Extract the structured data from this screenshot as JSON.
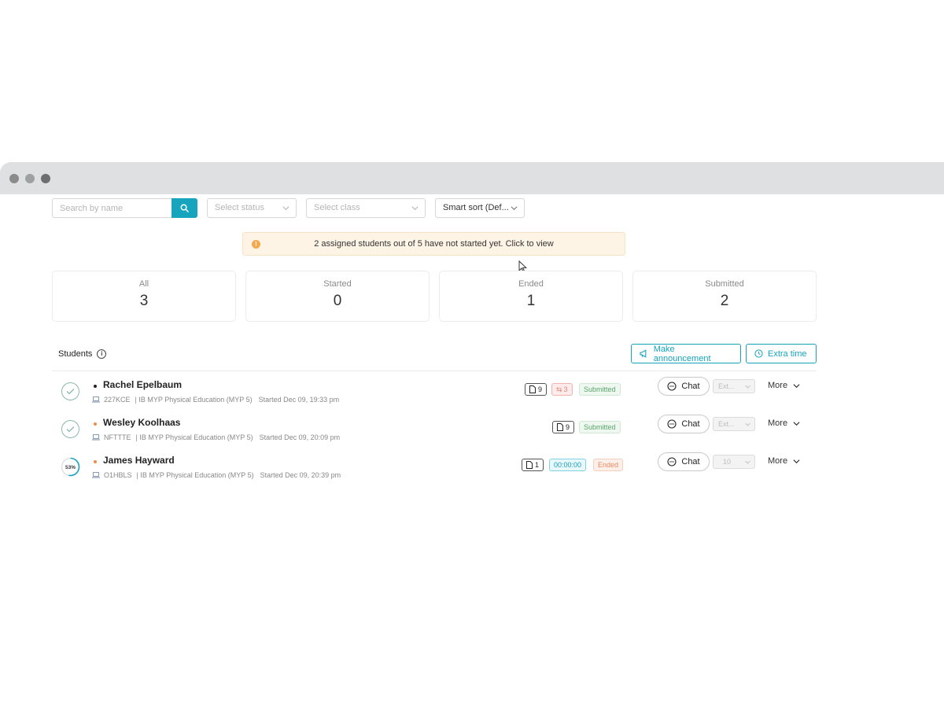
{
  "filters": {
    "search_placeholder": "Search by name",
    "status_placeholder": "Select status",
    "class_placeholder": "Select class",
    "sort_value": "Smart sort (Def..."
  },
  "notice": {
    "text": "2 assigned students out of 5 have not started yet. Click to view"
  },
  "stats": [
    {
      "label": "All",
      "value": "3"
    },
    {
      "label": "Started",
      "value": "0"
    },
    {
      "label": "Ended",
      "value": "1"
    },
    {
      "label": "Submitted",
      "value": "2"
    }
  ],
  "students_section": {
    "title": "Students",
    "announce_label": "Make announcement",
    "extra_time_label": "Extra time"
  },
  "students": [
    {
      "name": "Rachel Epelbaum",
      "code": "227KCE",
      "class": "| IB MYP Physical Education (MYP 5)",
      "started": "Started Dec 09, 19:33 pm",
      "status": "done",
      "presence": "online",
      "docs": "9",
      "flags": "3",
      "state_label": "Submitted",
      "chat_label": "Chat",
      "ext_value": "Ext...",
      "more_label": "More"
    },
    {
      "name": "Wesley Koolhaas",
      "code": "NFTTTE",
      "class": "| IB MYP Physical Education (MYP 5)",
      "started": "Started Dec 09, 20:09 pm",
      "status": "done",
      "presence": "away",
      "docs": "9",
      "state_label": "Submitted",
      "chat_label": "Chat",
      "ext_value": "Ext...",
      "more_label": "More"
    },
    {
      "name": "James Hayward",
      "code": "O1HBLS",
      "class": "| IB MYP Physical Education (MYP 5)",
      "started": "Started Dec 09, 20:39 pm",
      "status": "progress",
      "progress_label": "53%",
      "progress": 0.53,
      "presence": "away",
      "docs": "1",
      "timer": "00:00:00",
      "state_label": "Ended",
      "chat_label": "Chat",
      "ext_value": "10",
      "more_label": "More"
    }
  ],
  "colors": {
    "accent": "#16a5bd",
    "submitted": "#5aa56c",
    "ended": "#e58a61",
    "warning": "#f3a94d"
  }
}
